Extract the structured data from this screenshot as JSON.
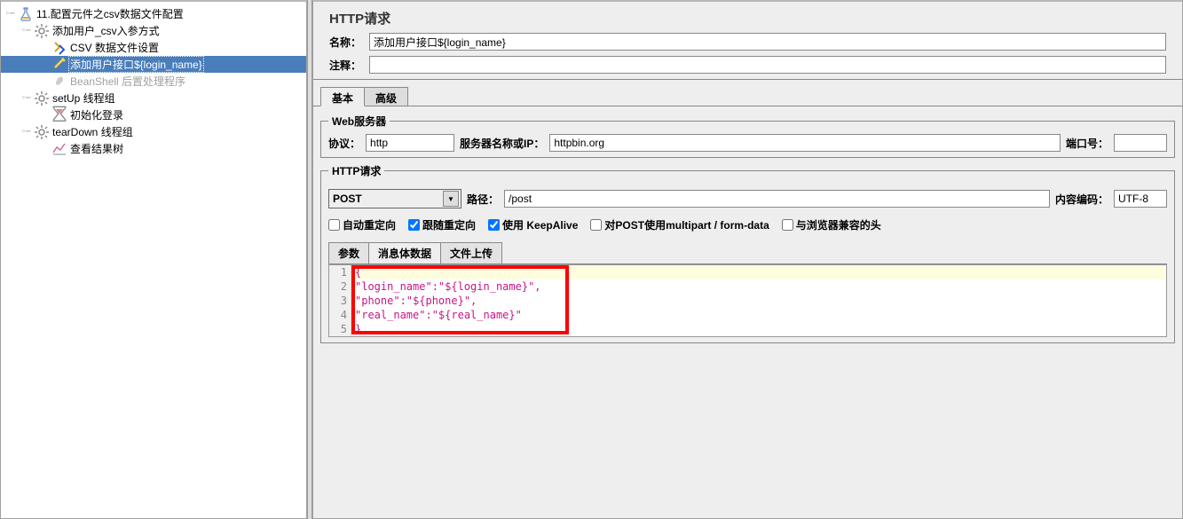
{
  "tree": {
    "root": {
      "label": "11.配置元件之csv数据文件配置",
      "children": [
        {
          "label": "添加用户_csv入参方式",
          "children": [
            {
              "label": "CSV 数据文件设置"
            },
            {
              "label": "添加用户接口${login_name}",
              "selected": true
            },
            {
              "label": "BeanShell 后置处理程序",
              "disabled": true
            }
          ]
        },
        {
          "label": "setUp 线程组",
          "children": [
            {
              "label": "初始化登录"
            }
          ]
        },
        {
          "label": "tearDown 线程组",
          "children": [
            {
              "label": "查看结果树"
            }
          ]
        }
      ]
    }
  },
  "editor": {
    "title": "HTTP请求",
    "name_label": "名称：",
    "name_value": "添加用户接口${login_name}",
    "comment_label": "注释：",
    "comment_value": "",
    "tab_basic": "基本",
    "tab_advanced": "高级",
    "webserver": {
      "legend": "Web服务器",
      "protocol_label": "协议：",
      "protocol_value": "http",
      "server_label": "服务器名称或IP：",
      "server_value": "httpbin.org",
      "port_label": "端口号："
    },
    "request": {
      "legend": "HTTP请求",
      "method": "POST",
      "path_label": "路径：",
      "path_value": "/post",
      "encoding_label": "内容编码：",
      "encoding_value": "UTF-8"
    },
    "checks": {
      "auto_redirect": "自动重定向",
      "follow_redirect": "跟随重定向",
      "keep_alive": "使用 KeepAlive",
      "multipart": "对POST使用multipart / form-data",
      "browser_headers": "与浏览器兼容的头"
    },
    "body_tabs": {
      "params": "参数",
      "body": "消息体数据",
      "files": "文件上传"
    },
    "body_lines": [
      "{",
      "  \"login_name\":\"${login_name}\",",
      "  \"phone\":\"${phone}\",",
      "  \"real_name\":\"${real_name}\"",
      "}"
    ]
  }
}
